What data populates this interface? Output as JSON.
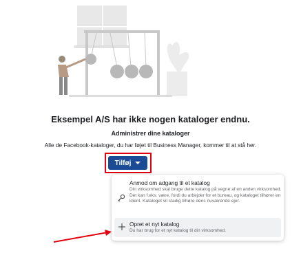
{
  "empty_state": {
    "title": "Eksempel A/S har ikke nogen kataloger endnu.",
    "subtitle": "Administrer dine kataloger",
    "description": "Alle de Facebook-kataloger, du har føjet til Business Manager, kommer til at stå her."
  },
  "add_button": {
    "label": "Tilføj",
    "icon": "chevron-down-icon"
  },
  "menu": {
    "items": [
      {
        "title": "Anmod om adgang til et katalog",
        "description": "Din virksomhed skal bruge dette katalog på vegne af en anden virksomhed. Det kan f.eks. være, fordi du arbejder for et bureau, og kataloget tilhører en klient. Kataloget vil stadig tilhøre dens nuværende ejer.",
        "icon": "key-icon"
      },
      {
        "title": "Opret et nyt katalog",
        "description": "Du har brug for et nyt katalog til din virksomhed.",
        "icon": "plus-icon"
      }
    ]
  },
  "colors": {
    "button_bg": "#1a4b94",
    "highlight": "#e3000f",
    "hover_bg": "#f0f1f3"
  }
}
